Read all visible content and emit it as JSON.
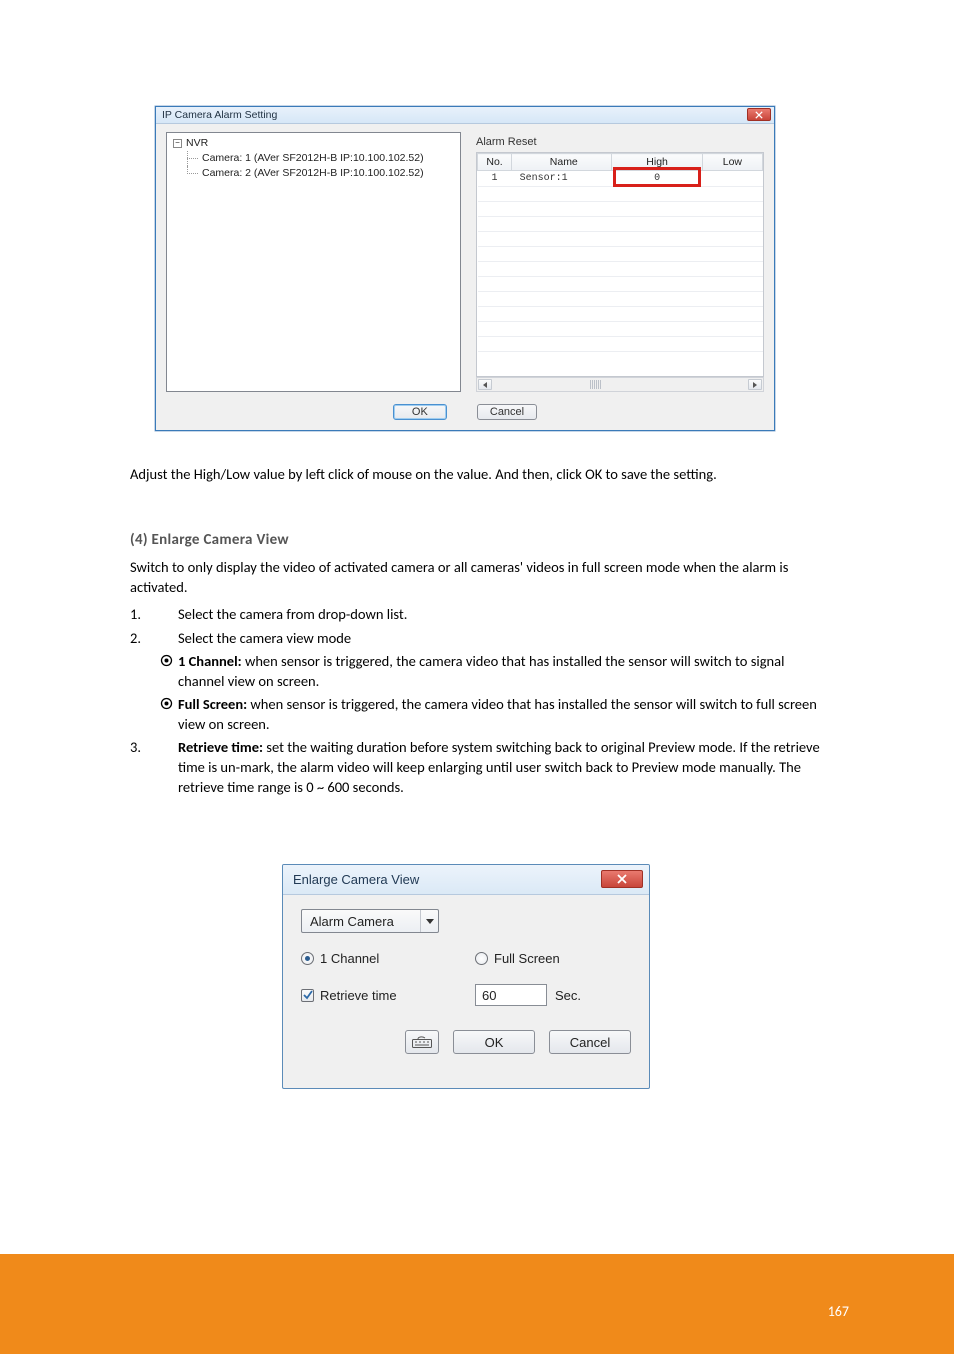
{
  "dialog1": {
    "title": "IP Camera Alarm Setting",
    "tree": {
      "root": "NVR",
      "children": [
        "Camera: 1 (AVer SF2012H-B IP:10.100.102.52)",
        "Camera: 2 (AVer SF2012H-B IP:10.100.102.52)"
      ]
    },
    "alarm_reset_label": "Alarm Reset",
    "table": {
      "headers": {
        "no": "No.",
        "name": "Name",
        "high": "High",
        "low": "Low"
      },
      "row": {
        "no": "1",
        "name": "Sensor:1",
        "high": "0",
        "low": ""
      }
    },
    "buttons": {
      "ok": "OK",
      "cancel": "Cancel"
    }
  },
  "body_text": {
    "para1": "Adjust the High/Low value by left click of mouse on the value. And then, click OK to save the setting.",
    "heading": "(4) Enlarge Camera View",
    "para2a": "Switch to only display the video of activated camera or all cameras' videos in full screen mode when the alarm is activated.",
    "list": {
      "item1_num": "1.",
      "item1": "Select the camera from drop-down list.",
      "item2_num": "2.",
      "item2": "Select the camera view mode",
      "sub1_label": "1 Channel:",
      "sub1_text": " when sensor is triggered, the camera video that has installed the sensor will switch to signal channel view on screen.",
      "sub2_label": "Full Screen:",
      "sub2_text": " when sensor is triggered, the camera video that has installed the sensor will switch to full screen view on screen.",
      "item3_num": "3.",
      "item3_label": "Retrieve time:",
      "item3_text": " set the waiting duration before system switching back to original Preview mode. If the retrieve time is un-mark, the alarm video will keep enlarging until user switch back to Preview mode manually. The retrieve time range is 0 ~ 600 seconds."
    }
  },
  "dialog2": {
    "title": "Enlarge Camera View",
    "combo": "Alarm Camera",
    "radio1": "1 Channel",
    "radio2": "Full Screen",
    "checkbox": "Retrieve time",
    "secs_value": "60",
    "secs_unit": "Sec.",
    "buttons": {
      "ok": "OK",
      "cancel": "Cancel"
    }
  },
  "page_number": "167"
}
